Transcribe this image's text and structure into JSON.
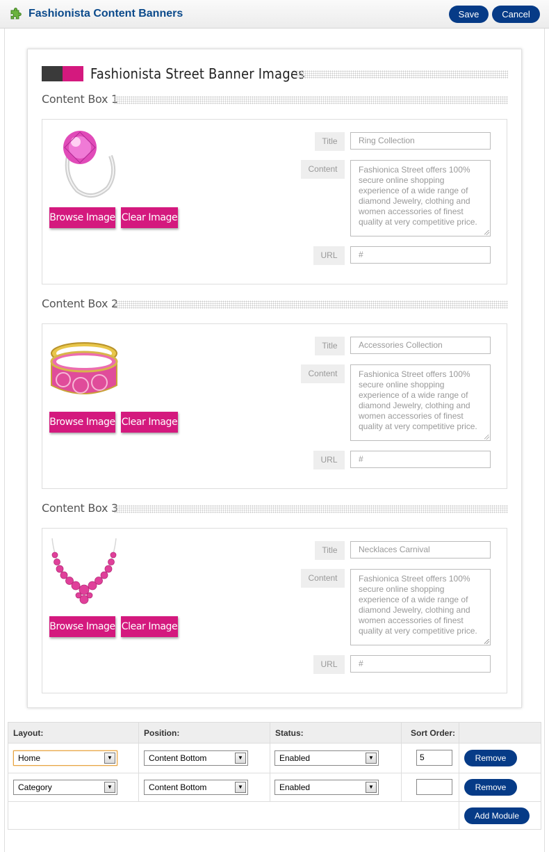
{
  "header": {
    "title": "Fashionista Content Banners",
    "save_label": "Save",
    "cancel_label": "Cancel"
  },
  "panel": {
    "title": "Fashionista Street Banner Images",
    "accent_colors": [
      "#3a3a3a",
      "#d4197e"
    ]
  },
  "content_boxes": [
    {
      "heading": "Content Box 1",
      "image": "pink-gemstone-ring",
      "browse_label": "Browse Image",
      "clear_label": "Clear Image",
      "title_label": "Title",
      "title_value": "Ring Collection",
      "content_label": "Content",
      "content_value": "Fashionica Street offers 100%\nsecure online  shopping\nexperience of a wide range of\ndiamond Jewelry, clothing  and\nwomen accessories  of finest\nquality at very competitive price.",
      "url_label": "URL",
      "url_value": "#"
    },
    {
      "heading": "Content Box 2",
      "image": "pink-gold-bangles",
      "browse_label": "Browse Image",
      "clear_label": "Clear Image",
      "title_label": "Title",
      "title_value": "Accessories Collection",
      "content_label": "Content",
      "content_value": "Fashionica Street offers 100%\nsecure online  shopping\nexperience of a wide range of\ndiamond Jewelry, clothing  and\nwomen accessories  of finest\nquality at very competitive price.",
      "url_label": "URL",
      "url_value": "#"
    },
    {
      "heading": "Content Box 3",
      "image": "pink-bead-necklace",
      "browse_label": "Browse Image",
      "clear_label": "Clear Image",
      "title_label": "Title",
      "title_value": "Necklaces Carnival",
      "content_label": "Content",
      "content_value": "Fashionica Street offers 100%\nsecure online  shopping\nexperience of a wide range of\ndiamond Jewelry, clothing  and\nwomen accessories  of finest\nquality at very competitive price.",
      "url_label": "URL",
      "url_value": "#"
    }
  ],
  "modules": {
    "columns": [
      "Layout:",
      "Position:",
      "Status:",
      "Sort Order:"
    ],
    "rows": [
      {
        "layout": "Home",
        "position": "Content Bottom",
        "status": "Enabled",
        "sort_order": "5",
        "remove_label": "Remove"
      },
      {
        "layout": "Category",
        "position": "Content Bottom",
        "status": "Enabled",
        "sort_order": "",
        "remove_label": "Remove"
      }
    ],
    "add_label": "Add Module"
  },
  "colors": {
    "brand_blue": "#063b87",
    "title_blue": "#0b4a8b",
    "accent_pink": "#d4197e"
  }
}
